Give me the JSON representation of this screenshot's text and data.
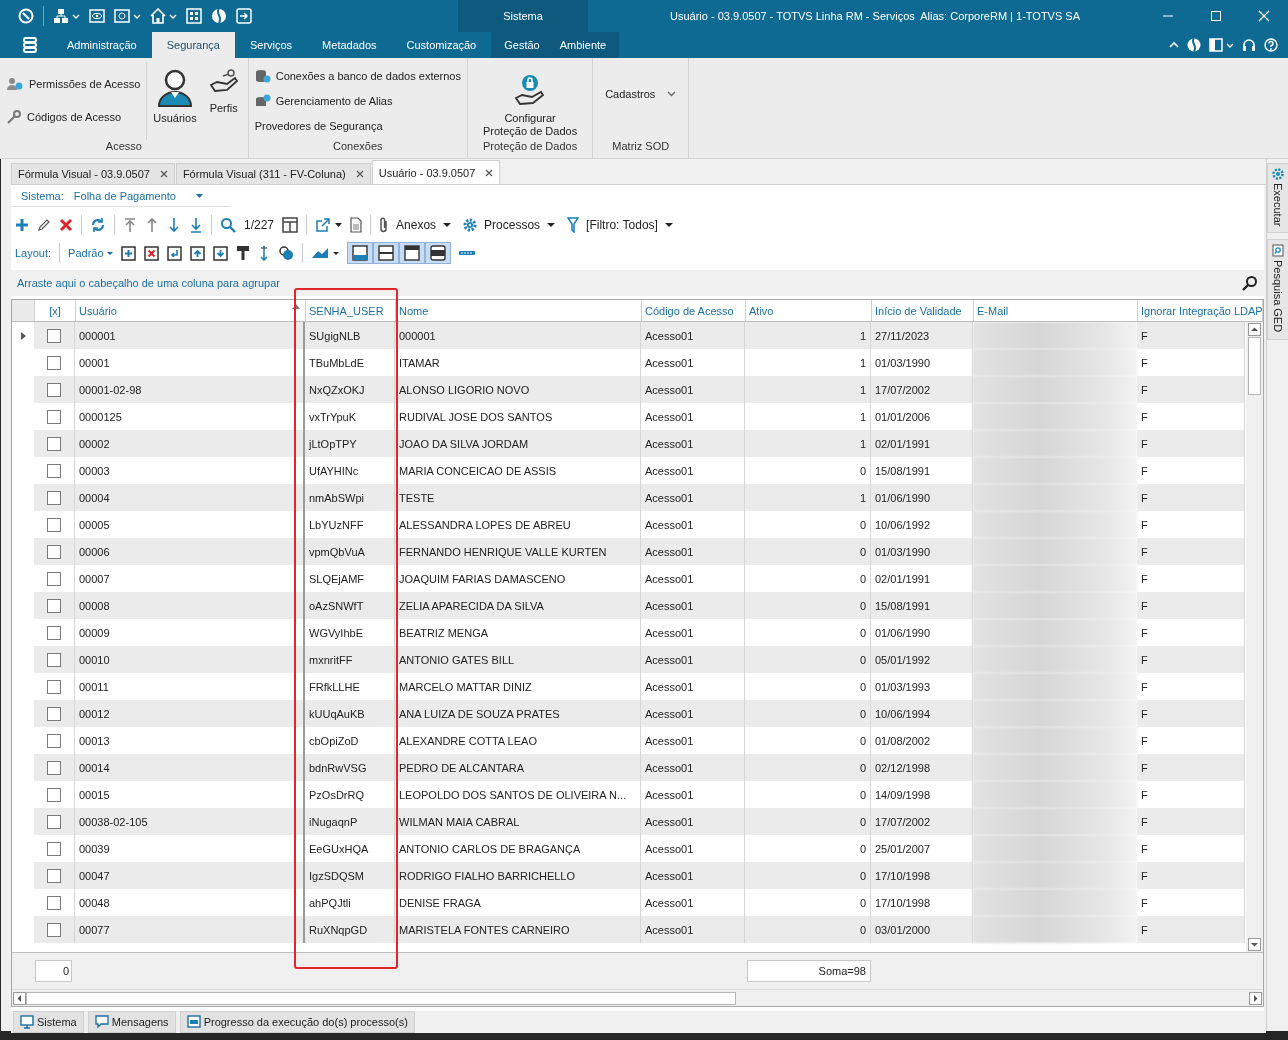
{
  "title_bar": {
    "context_label": "Sistema",
    "title": "Usuário - 03.9.0507 - TOTVS Linha RM - Serviços  Alias: CorporeRM | 1-TOTVS SA"
  },
  "ribbon_tabs": [
    {
      "label": "Administração",
      "selected": false,
      "contextual": false
    },
    {
      "label": "Segurança",
      "selected": true,
      "contextual": false
    },
    {
      "label": "Serviços",
      "selected": false,
      "contextual": false
    },
    {
      "label": "Metadados",
      "selected": false,
      "contextual": false
    },
    {
      "label": "Customização",
      "selected": false,
      "contextual": false
    },
    {
      "label": "Gestão",
      "selected": false,
      "contextual": true
    },
    {
      "label": "Ambiente",
      "selected": false,
      "contextual": true
    }
  ],
  "ribbon_groups": [
    {
      "title": "Acesso",
      "items": [
        {
          "label": "Permissões de Acesso",
          "kind": "small"
        },
        {
          "label": "Códigos de Acesso",
          "kind": "small"
        },
        {
          "label": "Usuários",
          "kind": "large"
        },
        {
          "label": "Perfis",
          "kind": "large"
        }
      ]
    },
    {
      "title": "Conexões",
      "items": [
        {
          "label": "Conexões a banco de dados externos",
          "kind": "small"
        },
        {
          "label": "Gerenciamento de Alias",
          "kind": "small"
        },
        {
          "label": "Provedores de Segurança",
          "kind": "small"
        }
      ]
    },
    {
      "title": "Proteção de Dados",
      "items": [
        {
          "label": "Configurar\nProteção de Dados",
          "kind": "large"
        }
      ]
    },
    {
      "title": "Matriz SOD",
      "items": [
        {
          "label": "Cadastros",
          "kind": "dropdown"
        }
      ]
    }
  ],
  "document_tabs": [
    {
      "label": "Fórmula Visual - 03.9.0507",
      "selected": false
    },
    {
      "label": "Fórmula Visual (311 - FV-Coluna)",
      "selected": false
    },
    {
      "label": "Usuário - 03.9.0507",
      "selected": true
    }
  ],
  "system_selector": {
    "label": "Sistema:",
    "value": "Folha de Pagamento"
  },
  "toolbar": {
    "record_position": "1/227",
    "menus": [
      {
        "label": "Anexos"
      },
      {
        "label": "Processos"
      },
      {
        "label": "[Filtro: Todos]"
      }
    ]
  },
  "layout_bar": {
    "label": "Layout:",
    "preset": "Padrão",
    "view_toggles": [
      {
        "selected": true
      },
      {
        "selected": true
      },
      {
        "selected": true
      },
      {
        "selected": true
      }
    ]
  },
  "group_hint": "Arraste aqui o cabeçalho de uma coluna para agrupar",
  "table": {
    "columns": [
      {
        "label": "[x]",
        "kind": "check",
        "highlighted": false,
        "sorted": false
      },
      {
        "label": "Usuário",
        "kind": "text",
        "highlighted": false,
        "sorted": true
      },
      {
        "label": "SENHA_USER",
        "kind": "text",
        "highlighted": true,
        "sorted": false
      },
      {
        "label": "Nome",
        "kind": "text",
        "highlighted": false,
        "sorted": false
      },
      {
        "label": "Código de Acesso",
        "kind": "text",
        "highlighted": false,
        "sorted": false
      },
      {
        "label": "Ativo",
        "kind": "number",
        "highlighted": false,
        "sorted": false
      },
      {
        "label": "Início de Validade",
        "kind": "text",
        "highlighted": false,
        "sorted": false
      },
      {
        "label": "E-Mail",
        "kind": "blurred",
        "highlighted": false,
        "sorted": false
      },
      {
        "label": "Ignorar Integração LDAP",
        "kind": "text",
        "highlighted": false,
        "sorted": false
      }
    ],
    "rows": [
      {
        "current": true,
        "checked": false,
        "cells": [
          "",
          "000001",
          "SUgigNLB",
          "000001",
          "Acesso01",
          "1",
          "27/11/2023",
          "",
          "F"
        ]
      },
      {
        "current": false,
        "checked": false,
        "cells": [
          "",
          "00001",
          "TBuMbLdE",
          "ITAMAR",
          "Acesso01",
          "1",
          "01/03/1990",
          "",
          "F"
        ]
      },
      {
        "current": false,
        "checked": false,
        "cells": [
          "",
          "00001-02-98",
          "NxQZxOKJ",
          "ALONSO LIGORIO NOVO",
          "Acesso01",
          "1",
          "17/07/2002",
          "",
          "F"
        ]
      },
      {
        "current": false,
        "checked": false,
        "cells": [
          "",
          "0000125",
          "vxTrYpuK",
          "RUDIVAL JOSE DOS SANTOS",
          "Acesso01",
          "1",
          "01/01/2006",
          "",
          "F"
        ]
      },
      {
        "current": false,
        "checked": false,
        "cells": [
          "",
          "00002",
          "jLtOpTPY",
          "JOAO DA SILVA JORDAM",
          "Acesso01",
          "1",
          "02/01/1991",
          "",
          "F"
        ]
      },
      {
        "current": false,
        "checked": false,
        "cells": [
          "",
          "00003",
          "UfAYHINc",
          "MARIA CONCEICAO DE ASSIS",
          "Acesso01",
          "0",
          "15/08/1991",
          "",
          "F"
        ]
      },
      {
        "current": false,
        "checked": false,
        "cells": [
          "",
          "00004",
          "nmAbSWpi",
          "TESTE",
          "Acesso01",
          "1",
          "01/06/1990",
          "",
          "F"
        ]
      },
      {
        "current": false,
        "checked": false,
        "cells": [
          "",
          "00005",
          "LbYUzNFF",
          "ALESSANDRA LOPES DE ABREU",
          "Acesso01",
          "0",
          "10/06/1992",
          "",
          "F"
        ]
      },
      {
        "current": false,
        "checked": false,
        "cells": [
          "",
          "00006",
          "vpmQbVuA",
          "FERNANDO HENRIQUE VALLE KURTEN",
          "Acesso01",
          "0",
          "01/03/1990",
          "",
          "F"
        ]
      },
      {
        "current": false,
        "checked": false,
        "cells": [
          "",
          "00007",
          "SLQEjAMF",
          "JOAQUIM FARIAS DAMASCENO",
          "Acesso01",
          "0",
          "02/01/1991",
          "",
          "F"
        ]
      },
      {
        "current": false,
        "checked": false,
        "cells": [
          "",
          "00008",
          "oAzSNWfT",
          "ZELIA APARECIDA DA SILVA",
          "Acesso01",
          "0",
          "15/08/1991",
          "",
          "F"
        ]
      },
      {
        "current": false,
        "checked": false,
        "cells": [
          "",
          "00009",
          "WGVyIhbE",
          "BEATRIZ MENGA",
          "Acesso01",
          "0",
          "01/06/1990",
          "",
          "F"
        ]
      },
      {
        "current": false,
        "checked": false,
        "cells": [
          "",
          "00010",
          "mxnritFF",
          "ANTONIO GATES BILL",
          "Acesso01",
          "0",
          "05/01/1992",
          "",
          "F"
        ]
      },
      {
        "current": false,
        "checked": false,
        "cells": [
          "",
          "00011",
          "FRfkLLHE",
          "MARCELO MATTAR DINIZ",
          "Acesso01",
          "0",
          "01/03/1993",
          "",
          "F"
        ]
      },
      {
        "current": false,
        "checked": false,
        "cells": [
          "",
          "00012",
          "kUUqAuKB",
          "ANA LUIZA  DE SOUZA PRATES",
          "Acesso01",
          "0",
          "10/06/1994",
          "",
          "F"
        ]
      },
      {
        "current": false,
        "checked": false,
        "cells": [
          "",
          "00013",
          "cbOpiZoD",
          "ALEXANDRE COTTA LEAO",
          "Acesso01",
          "0",
          "01/08/2002",
          "",
          "F"
        ]
      },
      {
        "current": false,
        "checked": false,
        "cells": [
          "",
          "00014",
          "bdnRwVSG",
          "PEDRO DE ALCANTARA",
          "Acesso01",
          "0",
          "02/12/1998",
          "",
          "F"
        ]
      },
      {
        "current": false,
        "checked": false,
        "cells": [
          "",
          "00015",
          "PzOsDrRQ",
          "LEOPOLDO DOS SANTOS DE OLIVEIRA N...",
          "Acesso01",
          "0",
          "14/09/1998",
          "",
          "F"
        ]
      },
      {
        "current": false,
        "checked": false,
        "cells": [
          "",
          "00038-02-105",
          "iNugaqnP",
          "WILMAN MAIA CABRAL",
          "Acesso01",
          "0",
          "17/07/2002",
          "",
          "F"
        ]
      },
      {
        "current": false,
        "checked": false,
        "cells": [
          "",
          "00039",
          "EeGUxHQA",
          "ANTONIO CARLOS DE BRAGANÇA",
          "Acesso01",
          "0",
          "25/01/2007",
          "",
          "F"
        ]
      },
      {
        "current": false,
        "checked": false,
        "cells": [
          "",
          "00047",
          "IgzSDQSM",
          "RODRIGO FIALHO BARRICHELLO",
          "Acesso01",
          "0",
          "17/10/1998",
          "",
          "F"
        ]
      },
      {
        "current": false,
        "checked": false,
        "cells": [
          "",
          "00048",
          "ahPQJtli",
          "DENISE FRAGA",
          "Acesso01",
          "0",
          "17/10/1998",
          "",
          "F"
        ]
      },
      {
        "current": false,
        "checked": false,
        "cells": [
          "",
          "00077",
          "RuXNqpGD",
          "MARISTELA FONTES CARNEIRO",
          "Acesso01",
          "0",
          "03/01/2000",
          "",
          "F"
        ]
      }
    ]
  },
  "footer": {
    "count": "0",
    "sum": "Soma=98"
  },
  "bottom_tabs": [
    {
      "label": "Sistema"
    },
    {
      "label": "Mensagens"
    },
    {
      "label": "Progresso da execução do(s) processo(s)"
    }
  ],
  "side_panel": [
    {
      "label": "Executar"
    },
    {
      "label": "Pesquisa GED"
    }
  ]
}
